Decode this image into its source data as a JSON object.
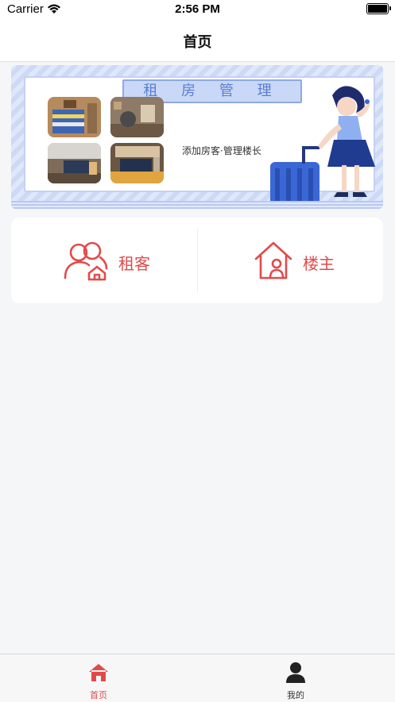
{
  "status_bar": {
    "carrier": "Carrier",
    "time": "2:56 PM"
  },
  "nav": {
    "title": "首页"
  },
  "banner": {
    "heading": "租 房 管 理",
    "tagline": "添加房客·管理楼长"
  },
  "actions": [
    {
      "label": "租客",
      "icon": "tenants-icon"
    },
    {
      "label": "楼主",
      "icon": "landlord-house-icon"
    }
  ],
  "tabs": [
    {
      "label": "首页",
      "icon": "home-icon",
      "active": true
    },
    {
      "label": "我的",
      "icon": "person-icon",
      "active": false
    }
  ],
  "colors": {
    "accent": "#e24a4a",
    "banner_blue": "#5b7dd3",
    "inactive": "#333333"
  }
}
